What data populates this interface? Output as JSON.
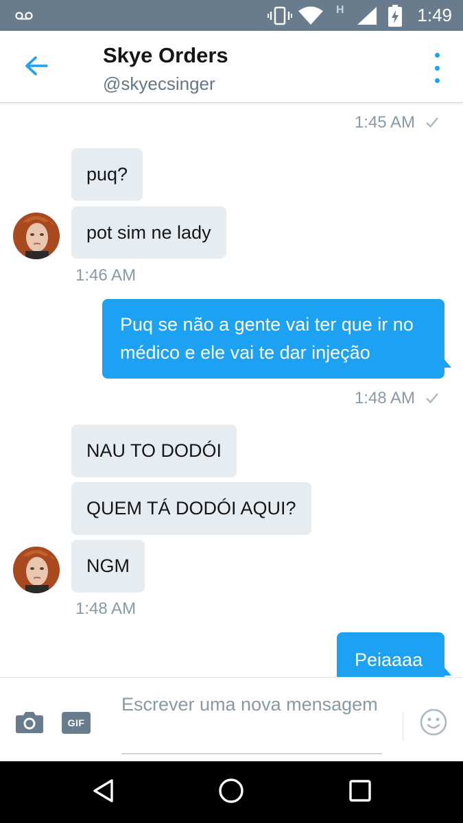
{
  "status_bar": {
    "time": "1:49",
    "network_label": "H",
    "icons": [
      "voicemail-icon",
      "vibrate-icon",
      "wifi-icon",
      "signal-icon",
      "battery-charging-icon"
    ]
  },
  "header": {
    "title": "Skye Orders",
    "handle": "@skyecsinger",
    "back_icon": "arrow-left-icon",
    "more_icon": "more-vertical-icon"
  },
  "messages": [
    {
      "type": "timestamp",
      "side": "right",
      "text": "1:45 AM",
      "read": true
    },
    {
      "type": "incoming",
      "text": "puq?"
    },
    {
      "type": "incoming",
      "text": "pot sim ne lady",
      "avatar": true
    },
    {
      "type": "timestamp",
      "side": "left",
      "text": "1:46 AM"
    },
    {
      "type": "outgoing",
      "text": "Puq se não a gente vai ter que ir no médico e ele vai te dar injeção"
    },
    {
      "type": "timestamp",
      "side": "right",
      "text": "1:48 AM",
      "read": true
    },
    {
      "type": "incoming",
      "text": "NAU TO DODÓI"
    },
    {
      "type": "incoming",
      "text": "QUEM TÁ DODÓI AQUI?"
    },
    {
      "type": "incoming",
      "text": "NGM",
      "avatar": true
    },
    {
      "type": "timestamp",
      "side": "left",
      "text": "1:48 AM"
    },
    {
      "type": "outgoing",
      "text": "Peiaaaa"
    }
  ],
  "compose": {
    "placeholder": "Escrever uma nova mensagem",
    "gif_label": "GIF",
    "camera_icon": "camera-icon",
    "emoji_icon": "emoji-icon"
  },
  "nav": {
    "icons": [
      "back-triangle-icon",
      "home-circle-icon",
      "recents-square-icon"
    ]
  },
  "colors": {
    "accent": "#1da1f2",
    "status_bar": "#687c8e",
    "incoming_bubble": "#e6ecf0",
    "timestamp": "#8899a6",
    "text": "#14171a"
  }
}
